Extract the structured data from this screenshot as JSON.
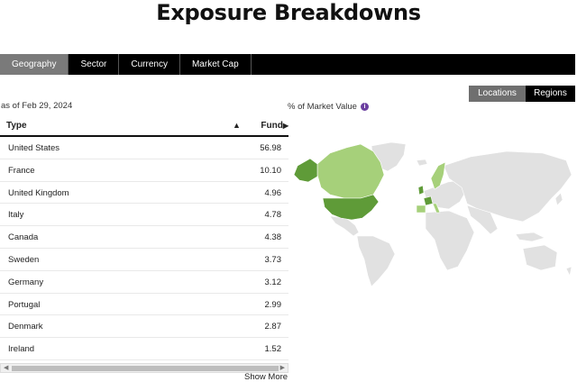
{
  "page": {
    "title": "Exposure Breakdowns"
  },
  "tabs": [
    {
      "label": "Geography",
      "active": true
    },
    {
      "label": "Sector",
      "active": false
    },
    {
      "label": "Currency",
      "active": false
    },
    {
      "label": "Market Cap",
      "active": false
    }
  ],
  "as_of": "as of Feb 29, 2024",
  "map_header": {
    "label": "% of Market Value",
    "info_icon": "info-icon"
  },
  "view_toggle": {
    "locations": "Locations",
    "regions": "Regions",
    "selected": "Locations"
  },
  "table": {
    "col_type": "Type",
    "col_fund": "Fund",
    "sort_icon": "▲",
    "fund_icon": "▶",
    "rows": [
      {
        "name": "United States",
        "value": "56.98"
      },
      {
        "name": "France",
        "value": "10.10"
      },
      {
        "name": "United Kingdom",
        "value": "4.96"
      },
      {
        "name": "Italy",
        "value": "4.78"
      },
      {
        "name": "Canada",
        "value": "4.38"
      },
      {
        "name": "Sweden",
        "value": "3.73"
      },
      {
        "name": "Germany",
        "value": "3.12"
      },
      {
        "name": "Portugal",
        "value": "2.99"
      },
      {
        "name": "Denmark",
        "value": "2.87"
      },
      {
        "name": "Ireland",
        "value": "1.52"
      }
    ]
  },
  "show_more": "Show More",
  "colors": {
    "tab_bar": "#000000",
    "tab_active": "#7a7a7a",
    "map_land": "#e1e1e1",
    "map_dark": "#5f9b38",
    "map_light": "#a6d07a",
    "info": "#6b3fa0"
  }
}
